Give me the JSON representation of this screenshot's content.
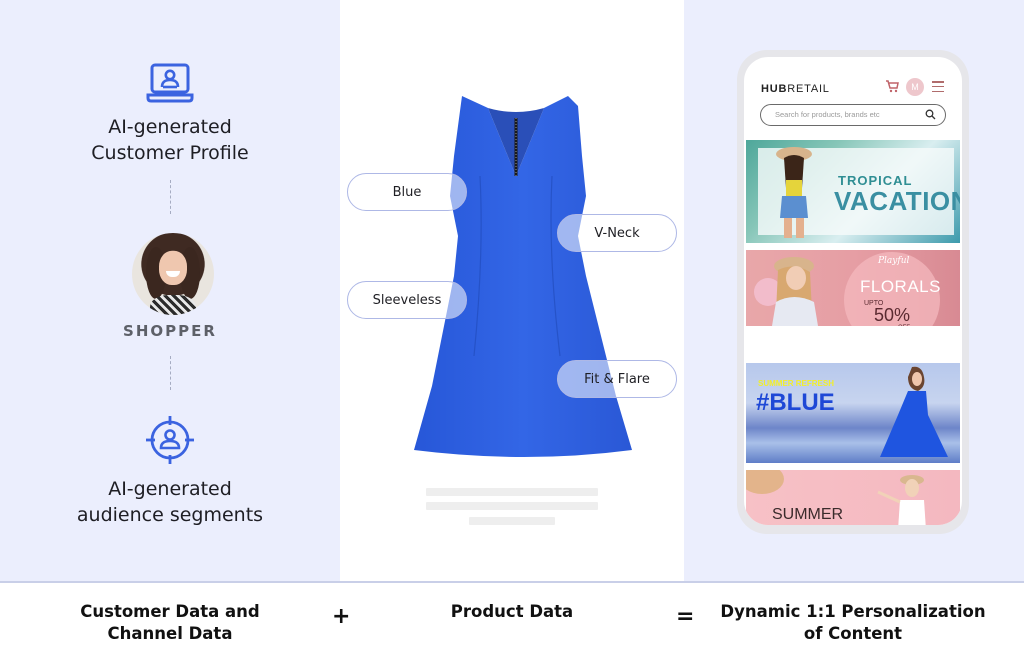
{
  "left": {
    "items": [
      {
        "icon": "laptop-user-icon",
        "label_lines": [
          "AI-generated",
          "Customer Profile"
        ]
      },
      {
        "icon": "target-user-icon",
        "label_lines": [
          "AI-generated",
          "audience segments"
        ]
      }
    ],
    "shopper": {
      "label": "SHOPPER",
      "avatar": "shopper-avatar"
    }
  },
  "product": {
    "image": "blue-dress",
    "tags": [
      "Blue",
      "V-Neck",
      "Sleeveless",
      "Fit & Flare"
    ]
  },
  "phone": {
    "brand_bold": "HUB",
    "brand_rest": "RETAIL",
    "user_initial": "M",
    "search_placeholder": "Search for  products, brands etc",
    "banners": [
      {
        "lines": [
          "TROPICAL",
          "VACATION"
        ]
      },
      {
        "lines": [
          "Playful",
          "FLORALS",
          "UPTO",
          "50%",
          "OFF"
        ]
      },
      {
        "lines": [
          "SUMMER REFRESH",
          "#BLUE"
        ]
      },
      {
        "lines": [
          "SUMMER"
        ]
      }
    ]
  },
  "equation": {
    "term1_lines": [
      "Customer Data and",
      "Channel Data"
    ],
    "plus": "+",
    "term2": "Product Data",
    "equals": "=",
    "result_lines": [
      "Dynamic 1:1 Personalization",
      "of Content"
    ]
  },
  "colors": {
    "accent_blue": "#3b63e0",
    "panel_bg": "#ebeefd",
    "dress_blue": "#2f5ee0"
  }
}
